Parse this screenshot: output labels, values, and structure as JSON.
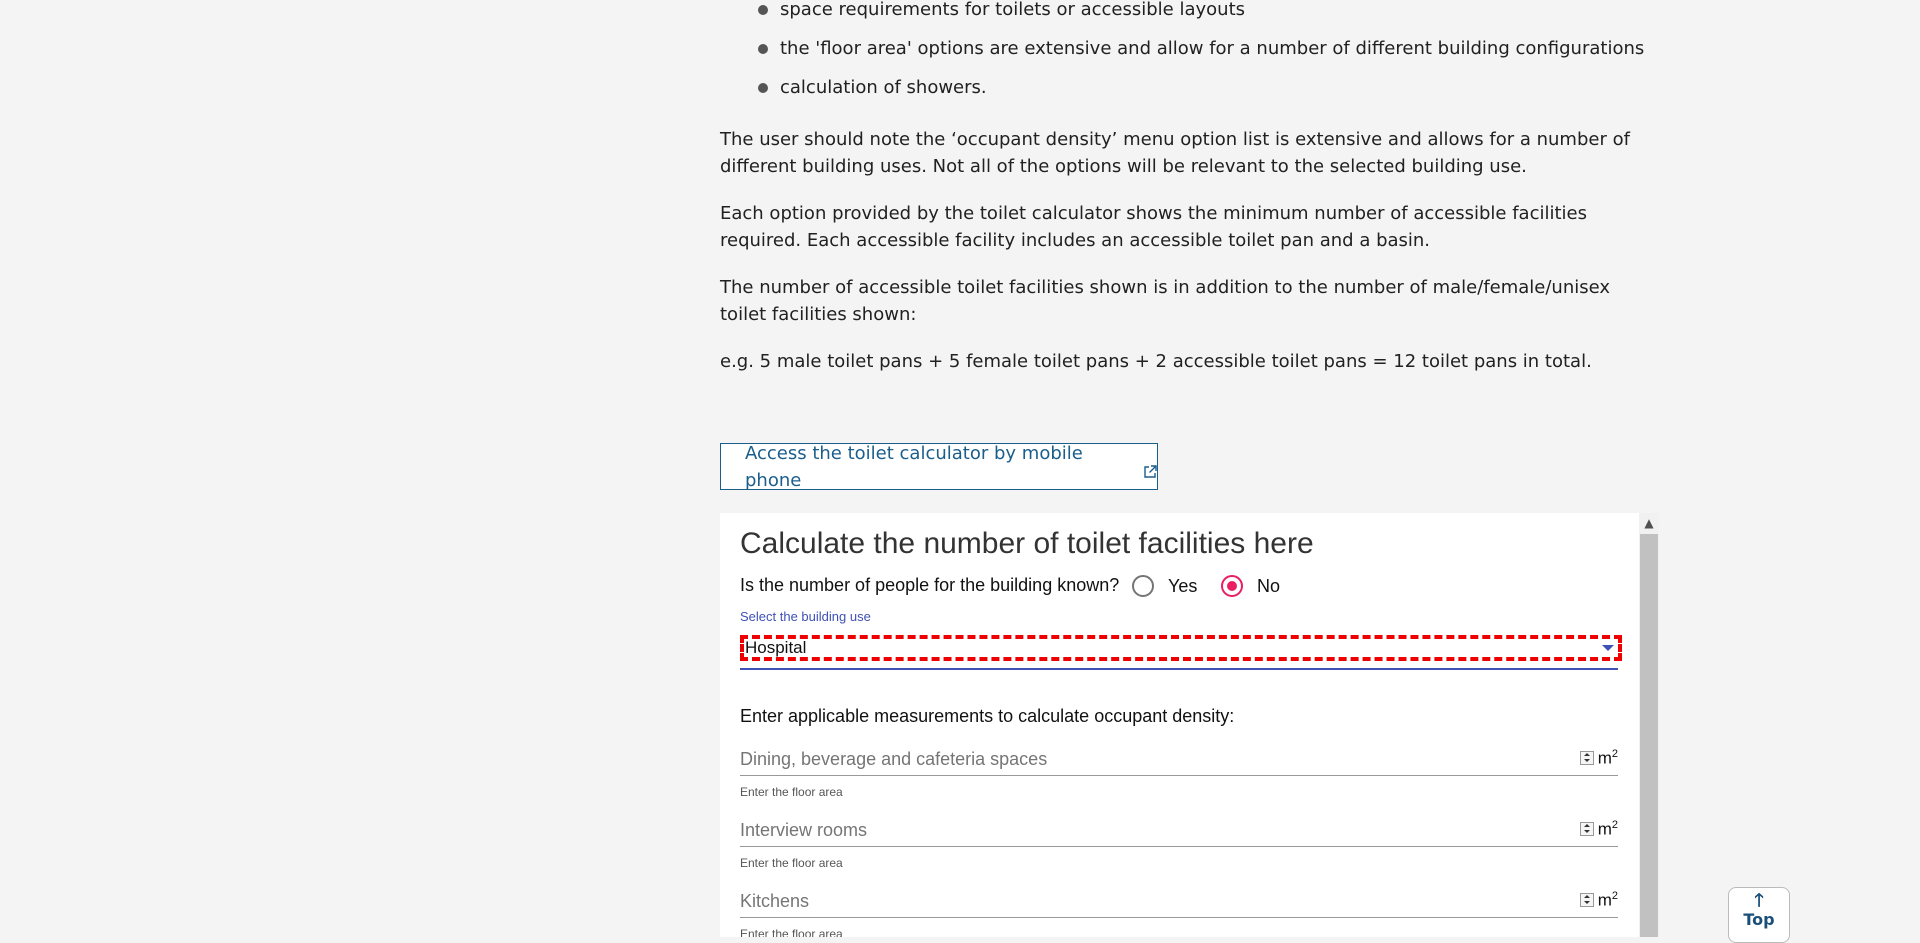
{
  "bullets": [
    "space requirements for toilets or accessible layouts",
    "the 'floor area' options are extensive and allow for a number of different building configurations",
    "calculation of showers."
  ],
  "paragraphs": [
    "The user should note the ‘occupant density’ menu option list is extensive and allows for a number of different building uses. Not all of the options will be relevant to the selected building use.",
    "Each option provided by the toilet calculator shows the minimum number of accessible facilities required. Each accessible facility includes an accessible toilet pan and a basin.",
    "The number of accessible toilet facilities shown is in addition to the number of male/female/unisex toilet facilities shown:",
    "e.g. 5 male toilet pans + 5 female toilet pans + 2 accessible toilet pans = 12 toilet pans in total."
  ],
  "mobile_link": {
    "label": "Access the toilet calculator by mobile phone",
    "icon": "external-link-icon"
  },
  "calculator": {
    "title": "Calculate the number of toilet facilities here",
    "question": "Is the number of people for the building known?",
    "options": [
      {
        "label": "Yes",
        "selected": false
      },
      {
        "label": "No",
        "selected": true
      }
    ],
    "select_label": "Select the building use",
    "select_value": "Hospital",
    "measurements_heading": "Enter applicable measurements to calculate occupant density:",
    "fields": [
      {
        "placeholder": "Dining, beverage and cafeteria spaces",
        "unit": "m",
        "unit_sup": "2",
        "hint": "Enter the floor area"
      },
      {
        "placeholder": "Interview rooms",
        "unit": "m",
        "unit_sup": "2",
        "hint": "Enter the floor area"
      },
      {
        "placeholder": "Kitchens",
        "unit": "m",
        "unit_sup": "2",
        "hint": "Enter the floor area"
      }
    ]
  },
  "top_button": {
    "label": "Top"
  },
  "colors": {
    "link": "#1a5e8c",
    "accent_radio": "#e91e63",
    "select_accent": "#3f51b5",
    "focus_outline": "#ee0000"
  }
}
